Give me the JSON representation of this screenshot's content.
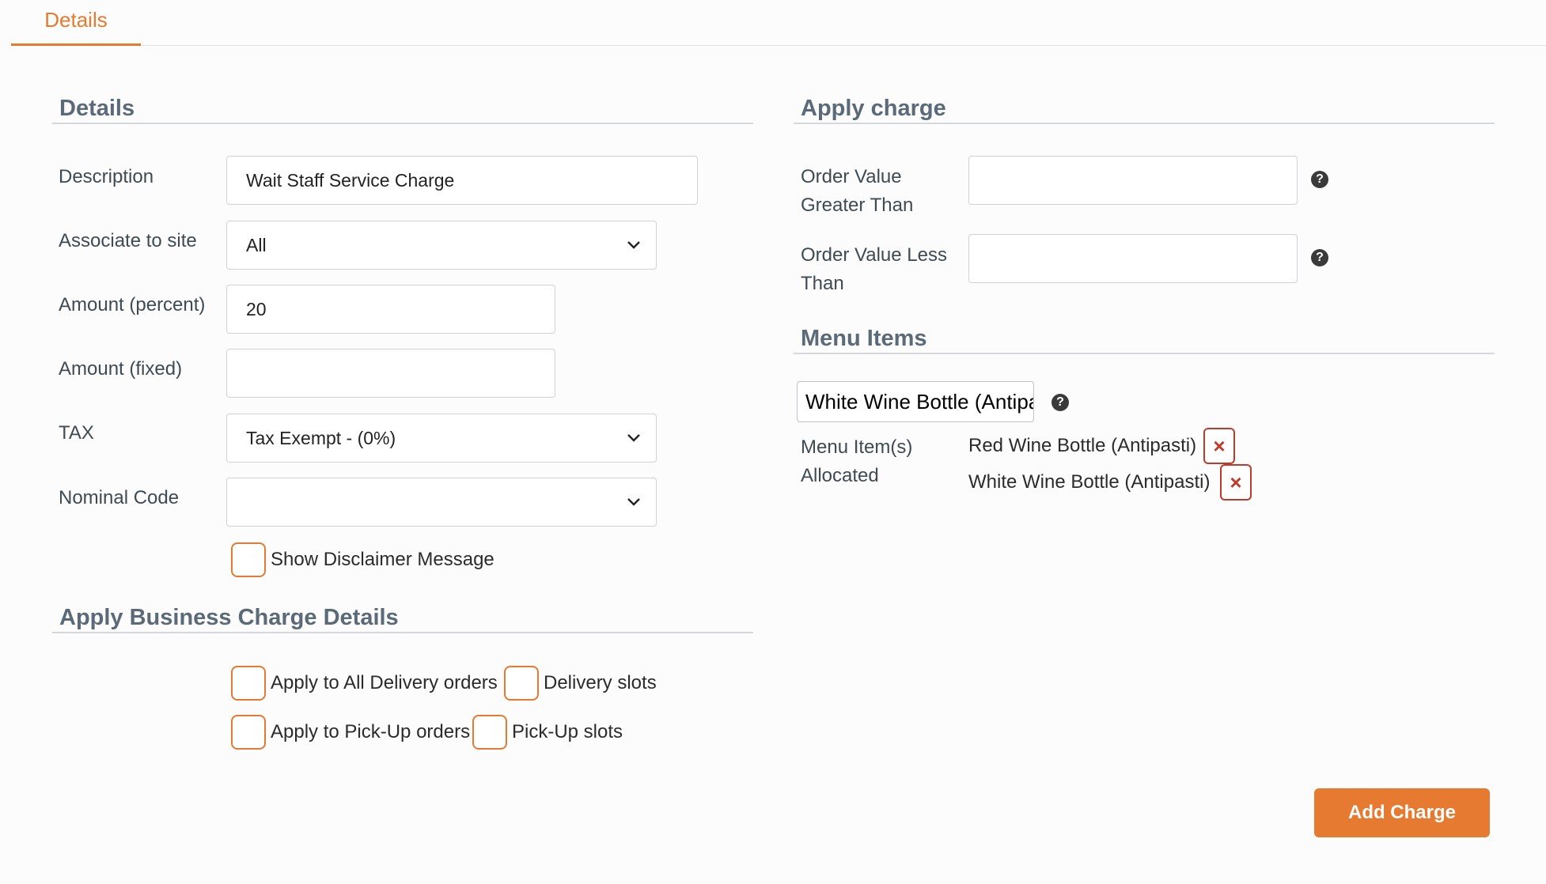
{
  "tabs": {
    "active_label": "Details"
  },
  "details": {
    "heading": "Details",
    "description_label": "Description",
    "description_value": "Wait Staff Service Charge",
    "site_label": "Associate to site",
    "site_value": "All",
    "amount_percent_label": "Amount (percent)",
    "amount_percent_value": "20",
    "amount_fixed_label": "Amount (fixed)",
    "amount_fixed_value": "",
    "tax_label": "TAX",
    "tax_value": "Tax Exempt - (0%)",
    "nominal_label": "Nominal Code",
    "nominal_value": "",
    "disclaimer_label": "Show Disclaimer Message"
  },
  "business": {
    "heading": "Apply Business Charge Details",
    "all_delivery_label": "Apply to All Delivery orders",
    "delivery_slots_label": "Delivery slots",
    "pickup_label": "Apply to Pick-Up orders",
    "pickup_slots_label": "Pick-Up slots"
  },
  "apply_charge": {
    "heading": "Apply charge",
    "greater_label_line1": "Order Value",
    "greater_label_line2": "Greater Than",
    "greater_value": "",
    "less_label_line1": "Order Value Less",
    "less_label_line2": "Than",
    "less_value": ""
  },
  "menu_items": {
    "heading": "Menu Items",
    "search_value": "White Wine Bottle (Antipasti)",
    "allocated_label_line1": "Menu Item(s)",
    "allocated_label_line2": "Allocated",
    "allocated": [
      "Red Wine Bottle (Antipasti)",
      "White Wine Bottle (Antipasti)"
    ]
  },
  "actions": {
    "add_label": "Add Charge"
  },
  "colors": {
    "accent": "#e67a30",
    "danger": "#c0392b",
    "heading": "#5a6a78"
  }
}
